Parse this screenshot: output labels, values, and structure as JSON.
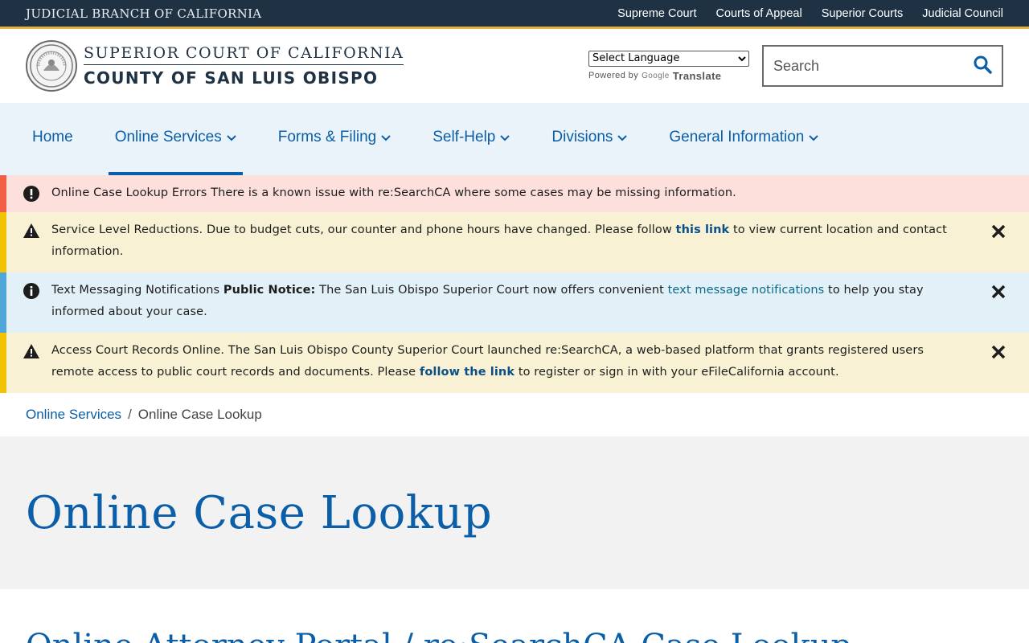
{
  "topbar": {
    "branch": "JUDICIAL BRANCH OF CALIFORNIA",
    "links": [
      "Supreme Court",
      "Courts of Appeal",
      "Superior Courts",
      "Judicial Council"
    ]
  },
  "header": {
    "logo_line1": "SUPERIOR COURT OF CALIFORNIA",
    "logo_line2": "COUNTY OF SAN LUIS OBISPO",
    "language_select": "Select Language",
    "powered_by": "Powered by",
    "google": "Google",
    "translate": "Translate",
    "search_placeholder": "Search"
  },
  "nav": {
    "items": [
      {
        "label": "Home",
        "has_dropdown": false
      },
      {
        "label": "Online Services",
        "has_dropdown": true,
        "active": true
      },
      {
        "label": "Forms & Filing",
        "has_dropdown": true
      },
      {
        "label": "Self-Help",
        "has_dropdown": true
      },
      {
        "label": "Divisions",
        "has_dropdown": true
      },
      {
        "label": "General Information",
        "has_dropdown": true
      }
    ]
  },
  "alerts": [
    {
      "type": "error",
      "title": "Online Case Lookup Errors",
      "text": "There is a known issue with re:SearchCA where some cases may be missing information."
    },
    {
      "type": "warning",
      "title": "Service Level Reductions.",
      "pre": "Due to budget cuts, our counter and phone hours have changed. Please follow",
      "link": "this link",
      "post": "to view current location and contact information."
    },
    {
      "type": "info",
      "title": "Text Messaging Notifications",
      "bold": "Public Notice:",
      "pre": "The San Luis Obispo Superior Court now offers convenient",
      "link": "text message notifications",
      "post": "to help you stay informed about your case."
    },
    {
      "type": "warning",
      "title": "Access Court Records Online.",
      "pre": "The San Luis Obispo County Superior Court launched re:SearchCA, a web-based platform that grants registered users remote access to public court records and documents. Please",
      "link": "follow the link",
      "post": "to register or sign in with your eFileCalifornia account."
    }
  ],
  "breadcrumb": {
    "parent": "Online Services",
    "separator": "/",
    "current": "Online Case Lookup"
  },
  "page": {
    "title": "Online Case Lookup",
    "subheading": "Online Attorney Portal / re:SearchCA Case Lookup"
  },
  "colors": {
    "topbar": "#1f3244",
    "accent_gold": "#e3b23c",
    "link_blue": "#0b5ea8",
    "nav_bg": "#eaf3fa",
    "alert_error": "#fde0dc",
    "alert_warning": "#f8f1d3",
    "alert_info": "#e2f0f7"
  }
}
